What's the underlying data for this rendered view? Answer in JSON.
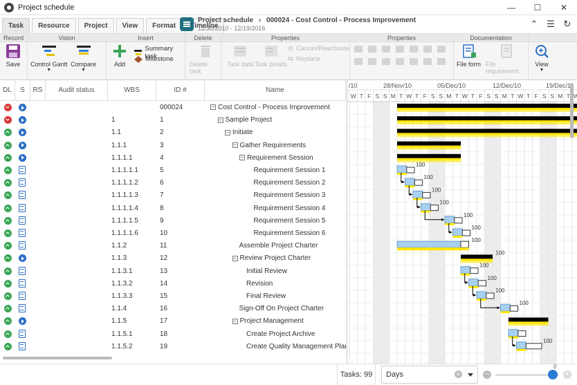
{
  "window": {
    "title": "Project schedule"
  },
  "tabs": [
    "Task",
    "Resource",
    "Project",
    "View",
    "Format",
    "Timeline"
  ],
  "doc": {
    "breadcrumb_root": "Project schedule",
    "breadcrumb_sep": "›",
    "breadcrumb_item": "000024 - Cost Control - Process Improvement",
    "dates": "11/30/2010 - 12/19/2016"
  },
  "ribbon": {
    "groups": {
      "record": "Record",
      "vision": "Vision",
      "insert": "Insert",
      "delete": "Delete",
      "properties1": "Properties",
      "properties2": "Properties",
      "documentation": "Documentation"
    },
    "buttons": {
      "save": "Save",
      "control_gantt": "Control Gantt",
      "compare": "Compare",
      "add": "Add",
      "summary_task": "Summary task",
      "milestone": "Milestone",
      "delete_task": "Delete task",
      "task_data": "Task data",
      "task_details": "Task details",
      "cancel_reactivate": "Cancel/Reactivate",
      "replace": "Replace",
      "file_form": "File form",
      "file_requirement": "File requirement",
      "view": "View"
    }
  },
  "grid": {
    "headers": {
      "dl": "DL",
      "s": "S",
      "rs": "RS",
      "audit": "Audit status",
      "wbs": "WBS",
      "id": "ID #",
      "name": "Name"
    },
    "rows": [
      {
        "dl": "red",
        "s": "play",
        "wbs": "",
        "id": "000024",
        "name": "Cost Control - Process Improvement",
        "level": 0,
        "expander": true
      },
      {
        "dl": "red",
        "s": "play",
        "wbs": "1",
        "id": "1",
        "name": "Sample Project",
        "level": 1,
        "expander": true
      },
      {
        "dl": "green",
        "s": "play",
        "wbs": "1.1",
        "id": "2",
        "name": "Initiate",
        "level": 2,
        "expander": true
      },
      {
        "dl": "green",
        "s": "play",
        "wbs": "1.1.1",
        "id": "3",
        "name": "Gather Requirements",
        "level": 3,
        "expander": true
      },
      {
        "dl": "green",
        "s": "play",
        "wbs": "1.1.1.1",
        "id": "4",
        "name": "Requirement Session",
        "level": 4,
        "expander": true
      },
      {
        "dl": "green",
        "s": "clip",
        "wbs": "1.1.1.1.1",
        "id": "5",
        "name": "Requirement Session 1",
        "level": 5,
        "expander": false
      },
      {
        "dl": "green",
        "s": "clip",
        "wbs": "1.1.1.1.2",
        "id": "6",
        "name": "Requirement Session 2",
        "level": 5,
        "expander": false
      },
      {
        "dl": "green",
        "s": "clip",
        "wbs": "1.1.1.1.3",
        "id": "7",
        "name": "Requirement Session 3",
        "level": 5,
        "expander": false
      },
      {
        "dl": "green",
        "s": "clip",
        "wbs": "1.1.1.1.4",
        "id": "8",
        "name": "Requirement Session 4",
        "level": 5,
        "expander": false
      },
      {
        "dl": "green",
        "s": "clip",
        "wbs": "1.1.1.1.5",
        "id": "9",
        "name": "Requirement Session 5",
        "level": 5,
        "expander": false
      },
      {
        "dl": "green",
        "s": "clip",
        "wbs": "1.1.1.1.6",
        "id": "10",
        "name": "Requirement Session 6",
        "level": 5,
        "expander": false
      },
      {
        "dl": "green",
        "s": "clip",
        "wbs": "1.1.2",
        "id": "11",
        "name": "Assemble Project Charter",
        "level": 3,
        "expander": false
      },
      {
        "dl": "green",
        "s": "play",
        "wbs": "1.1.3",
        "id": "12",
        "name": "Review Project Charter",
        "level": 3,
        "expander": true
      },
      {
        "dl": "green",
        "s": "clip",
        "wbs": "1.1.3.1",
        "id": "13",
        "name": "Initial Review",
        "level": 4,
        "expander": false
      },
      {
        "dl": "green",
        "s": "clip",
        "wbs": "1.1.3.2",
        "id": "14",
        "name": "Revision",
        "level": 4,
        "expander": false
      },
      {
        "dl": "green",
        "s": "clip",
        "wbs": "1.1.3.3",
        "id": "15",
        "name": "Final Review",
        "level": 4,
        "expander": false
      },
      {
        "dl": "green",
        "s": "clip",
        "wbs": "1.1.4",
        "id": "16",
        "name": "Sign-Off On Project Charter",
        "level": 3,
        "expander": false
      },
      {
        "dl": "green",
        "s": "play",
        "wbs": "1.1.5",
        "id": "17",
        "name": "Project Management",
        "level": 3,
        "expander": true
      },
      {
        "dl": "green",
        "s": "clip",
        "wbs": "1.1.5.1",
        "id": "18",
        "name": "Create Project Archive",
        "level": 4,
        "expander": false
      },
      {
        "dl": "green",
        "s": "clip",
        "wbs": "1.1.5.2",
        "id": "19",
        "name": "Create Quality Management Plan",
        "level": 4,
        "expander": false
      }
    ]
  },
  "gantt": {
    "weeks": [
      "/10",
      "28/Nov/10",
      "05/Dec/10",
      "12/Dec/10",
      "19/Dec/1"
    ],
    "day_letters": [
      "W",
      "T",
      "F",
      "S",
      "S",
      "M",
      "T",
      "W",
      "T",
      "F",
      "S",
      "S",
      "M",
      "T",
      "W",
      "T",
      "F",
      "S",
      "S",
      "M",
      "T",
      "W",
      "T",
      "F",
      "S",
      "S",
      "M",
      "T",
      "W"
    ],
    "progress_label": "100",
    "bars": [
      {
        "row": 0,
        "start": 6,
        "dur": 23,
        "type": "summary"
      },
      {
        "row": 1,
        "start": 6,
        "dur": 23,
        "type": "summary"
      },
      {
        "row": 2,
        "start": 6,
        "dur": 23,
        "type": "summary"
      },
      {
        "row": 3,
        "start": 6,
        "dur": 8,
        "type": "summary"
      },
      {
        "row": 4,
        "start": 6,
        "dur": 8,
        "type": "summary"
      },
      {
        "row": 5,
        "start": 6,
        "dur": 2,
        "type": "task",
        "label": true
      },
      {
        "row": 6,
        "start": 7,
        "dur": 2,
        "type": "task",
        "label": true
      },
      {
        "row": 7,
        "start": 8,
        "dur": 2,
        "type": "task",
        "label": true
      },
      {
        "row": 8,
        "start": 9,
        "dur": 2,
        "type": "task",
        "label": true
      },
      {
        "row": 9,
        "start": 12,
        "dur": 2,
        "type": "task",
        "label": true
      },
      {
        "row": 10,
        "start": 13,
        "dur": 2,
        "type": "task",
        "label": true
      },
      {
        "row": 11,
        "start": 6,
        "dur": 9,
        "type": "task-long",
        "label": true
      },
      {
        "row": 12,
        "start": 14,
        "dur": 4,
        "type": "summary-small",
        "label": true
      },
      {
        "row": 13,
        "start": 14,
        "dur": 2,
        "type": "task",
        "label": true
      },
      {
        "row": 14,
        "start": 15,
        "dur": 2,
        "type": "task",
        "label": true
      },
      {
        "row": 15,
        "start": 16,
        "dur": 2,
        "type": "task",
        "label": true
      },
      {
        "row": 16,
        "start": 19,
        "dur": 2,
        "type": "task",
        "label": true
      },
      {
        "row": 17,
        "start": 20,
        "dur": 5,
        "type": "summary",
        "label": false
      },
      {
        "row": 18,
        "start": 20,
        "dur": 2,
        "type": "task",
        "label": false
      },
      {
        "row": 19,
        "start": 21,
        "dur": 3,
        "type": "task",
        "label": true
      }
    ],
    "weekend_cols": [
      3,
      4,
      10,
      11,
      17,
      18,
      24,
      25
    ]
  },
  "status": {
    "tasks_label": "Tasks: 99",
    "scale_value": "Days",
    "zoom_value": "0"
  }
}
